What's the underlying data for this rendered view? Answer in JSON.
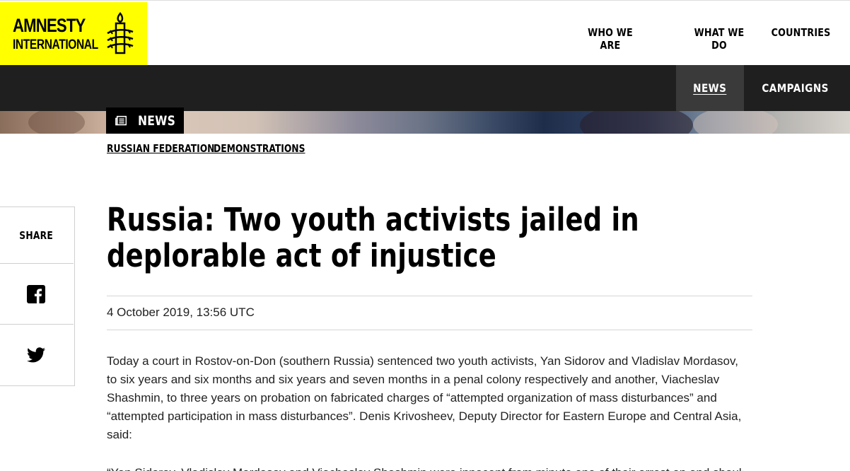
{
  "logo": {
    "line1": "AMNESTY",
    "line2": "INTERNATIONAL",
    "icon": "candle-barbed-wire-icon",
    "color": "#ffff00"
  },
  "top_nav": {
    "items": [
      {
        "label": "WHO WE ARE"
      },
      {
        "label": "WHAT WE DO"
      },
      {
        "label": "COUNTRIES"
      }
    ]
  },
  "sub_nav": {
    "items": [
      {
        "label": "NEWS",
        "active": true
      },
      {
        "label": "CAMPAIGNS",
        "active": false
      }
    ]
  },
  "section_tag": {
    "label": "NEWS",
    "icon": "newspaper-icon"
  },
  "tags": [
    {
      "label": "RUSSIAN FEDERATION"
    },
    {
      "label": "DEMONSTRATIONS"
    }
  ],
  "share": {
    "label": "SHARE",
    "buttons": [
      {
        "icon": "facebook-icon"
      },
      {
        "icon": "twitter-icon"
      }
    ]
  },
  "article": {
    "headline": "Russia: Two youth activists jailed in deplorable act of injustice",
    "date": "4 October 2019, 13:56 UTC",
    "paragraph1": "Today a court in Rostov-on-Don (southern Russia) sentenced two youth activists, Yan Sidorov and Vladislav Mordasov, to six years and six months and six years and seven months in a penal colony respectively and another, Viacheslav Shashmin, to three years on probation on fabricated charges of “attempted organization of mass disturbances” and “attempted participation in mass disturbances”. Denis Krivosheev, Deputy Director for Eastern Europe and Central Asia, said:",
    "paragraph2": "“Yan Sidorov, Vladislav Mordasov and Viacheslav Shashmin were innocent from minute one of their arrest on and shouldn’t be in prison. They are victims of”"
  },
  "colors": {
    "brand_yellow": "#ffff00",
    "dark_nav": "#1f1f1f",
    "active_nav": "#3a3a3a"
  }
}
